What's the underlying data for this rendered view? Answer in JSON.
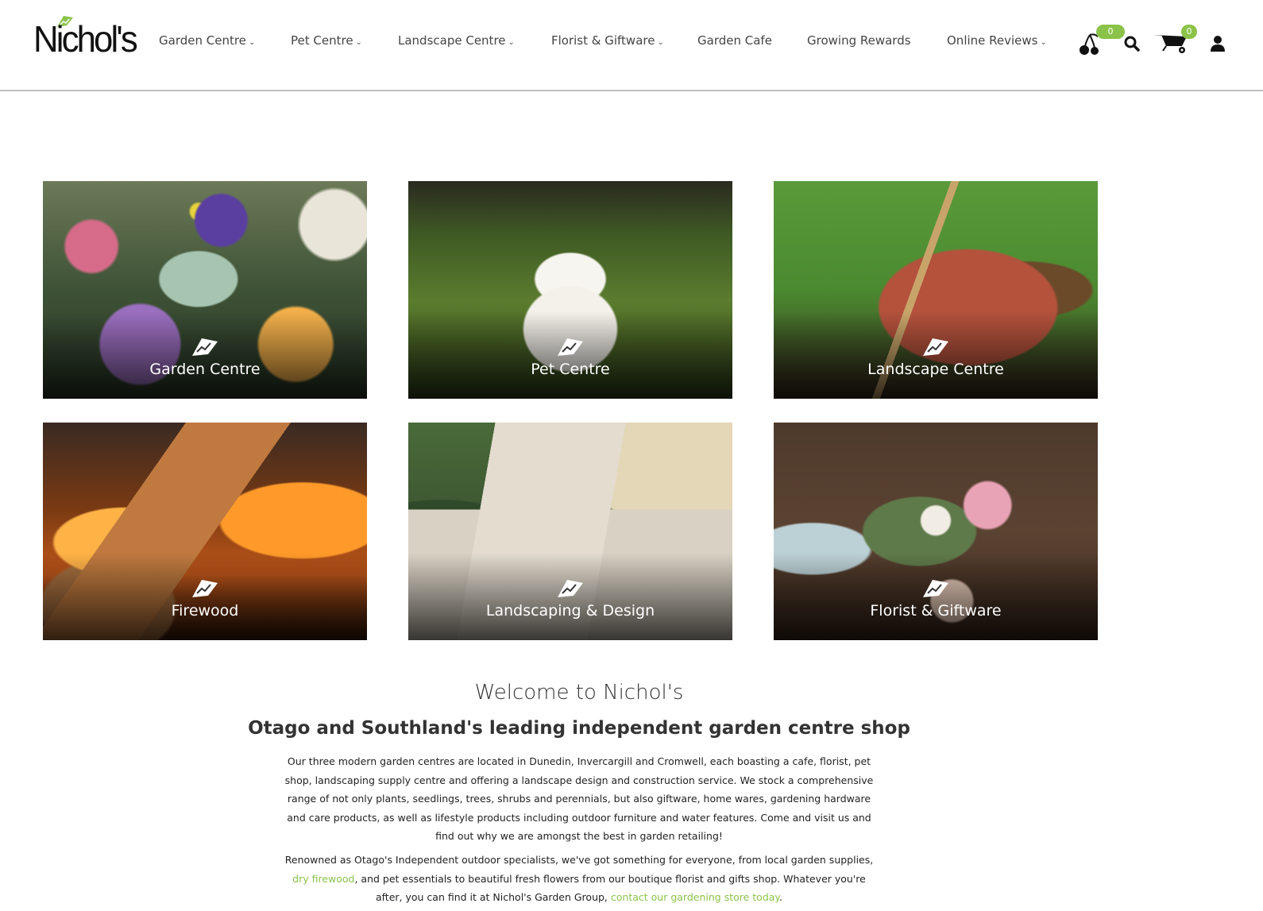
{
  "header": {
    "logo_text": "Nichol's",
    "nav": [
      {
        "label": "Garden Centre",
        "caret": "⌄"
      },
      {
        "label": "Pet Centre",
        "caret": "⌄"
      },
      {
        "label": "Landscape Centre",
        "caret": "⌄"
      },
      {
        "label": "Florist & Giftware",
        "caret": "⌄"
      },
      {
        "label": "Garden Cafe",
        "caret": ""
      },
      {
        "label": "Growing Rewards",
        "caret": ""
      },
      {
        "label": "Online Reviews",
        "caret": "⌄"
      }
    ],
    "icons": {
      "wishlist": "cherries-icon",
      "search": "search-icon",
      "cart": "wheelbarrow-cart-icon",
      "account": "user-icon"
    },
    "wishlist_count": "0",
    "cart_count": "0"
  },
  "tiles": [
    {
      "label": "Garden Centre",
      "image": "potted pansies and flowers photo"
    },
    {
      "label": "Pet Centre",
      "image": "white terrier dog on grass photo"
    },
    {
      "label": "Landscape Centre",
      "image": "wheelbarrow with spade and bark photo"
    },
    {
      "label": "Firewood",
      "image": "burning logs photo"
    },
    {
      "label": "Landscaping & Design",
      "image": "paved garden path photo"
    },
    {
      "label": "Florist & Giftware",
      "image": "flower bouquet on wooden table photo"
    }
  ],
  "welcome": {
    "title": "Welcome to Nichol's",
    "subtitle": "Otago and Southland's leading independent garden centre shop",
    "paragraph1": "Our three modern garden centres are located in Dunedin, Invercargill and Cromwell, each boasting a cafe, florist, pet shop, landscaping supply centre and offering a landscape design and construction service. We stock a comprehensive range of not only plants, seedlings, trees, shrubs and perennials, but also giftware, home wares, gardening hardware and care products, as well as lifestyle products including outdoor furniture and water features. Come and visit us and find out why we are amongst the best in garden retailing!",
    "paragraph2_a": "Renowned as Otago's Independent outdoor specialists, we've got something for everyone, from local garden supplies, ",
    "paragraph2_link1": "dry firewood",
    "paragraph2_b": ", and pet essentials to beautiful fresh flowers from our boutique florist and gifts shop. Whatever you're after, you can find it at Nichol's Garden Group, ",
    "paragraph2_link2": "contact our gardening store today",
    "paragraph2_c": "."
  },
  "colors": {
    "accent_green": "#8bc34a",
    "text": "#333333",
    "header_border": "#bdbdbd"
  }
}
